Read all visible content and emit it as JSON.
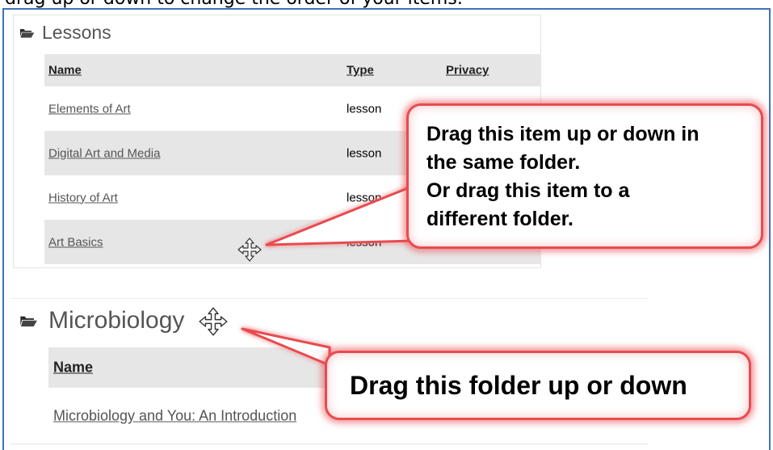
{
  "instruction": "drag up or down to change the order of your items.",
  "lessons": {
    "folder_name": "Lessons",
    "columns": {
      "name": "Name",
      "type": "Type",
      "privacy": "Privacy"
    },
    "rows": [
      {
        "name": "Elements of Art",
        "type": "lesson"
      },
      {
        "name": "Digital Art and Media",
        "type": "lesson"
      },
      {
        "name": "History of Art",
        "type": "lesson"
      },
      {
        "name": "Art Basics",
        "type": "lesson"
      }
    ]
  },
  "microbiology": {
    "folder_name": "Microbiology",
    "columns": {
      "name": "Name"
    },
    "rows": [
      {
        "name": "Microbiology and You: An Introduction"
      }
    ]
  },
  "callouts": {
    "item": {
      "line1": "Drag this item up or down in",
      "line2": "the same folder.",
      "line3": "Or drag this item to a",
      "line4": "different folder."
    },
    "folder": {
      "text": "Drag this folder up or down"
    }
  },
  "icons": {
    "folder": "folder-open-icon",
    "move": "move-cursor-icon"
  },
  "colors": {
    "frame": "#3e73b9",
    "callout_border": "#e84b4f",
    "row_shade": "#e6e6e6"
  }
}
